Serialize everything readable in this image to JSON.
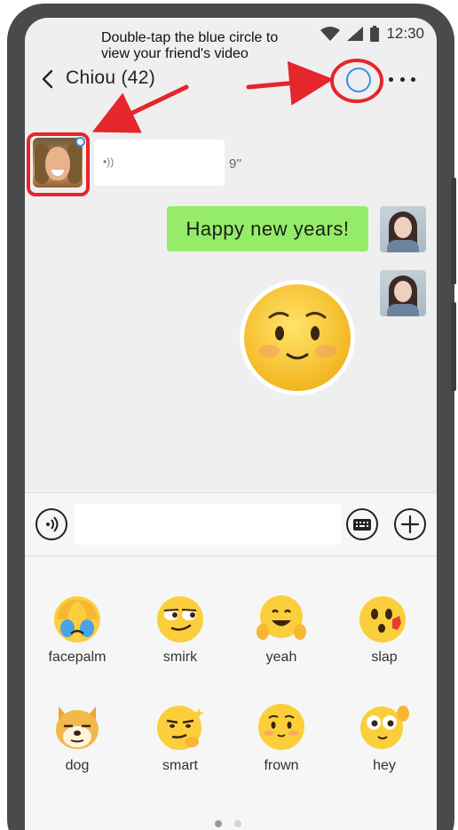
{
  "annotation": {
    "instruction_line1": "Double-tap the blue circle to",
    "instruction_line2": "view your friend's video",
    "highlight_color": "#e5262b"
  },
  "status_bar": {
    "time": "12:30"
  },
  "header": {
    "title": "Chiou (42)"
  },
  "messages": [
    {
      "sender": "friend",
      "type": "voice",
      "duration": "9''"
    },
    {
      "sender": "me",
      "type": "text",
      "text": "Happy new years!"
    },
    {
      "sender": "me",
      "type": "sticker",
      "sticker": "frown"
    }
  ],
  "stickers": [
    {
      "label": "facepalm",
      "icon": "facepalm-sticker-icon"
    },
    {
      "label": "smirk",
      "icon": "smirk-sticker-icon"
    },
    {
      "label": "yeah",
      "icon": "yeah-sticker-icon"
    },
    {
      "label": "slap",
      "icon": "slap-sticker-icon"
    },
    {
      "label": "dog",
      "icon": "dog-sticker-icon"
    },
    {
      "label": "smart",
      "icon": "smart-sticker-icon"
    },
    {
      "label": "frown",
      "icon": "frown-sticker-icon"
    },
    {
      "label": "hey",
      "icon": "hey-sticker-icon"
    }
  ],
  "colors": {
    "text_bubble": "#95ec69",
    "video_ring": "#3a8ee6",
    "emoji_yellow": "#fbcf3c"
  }
}
